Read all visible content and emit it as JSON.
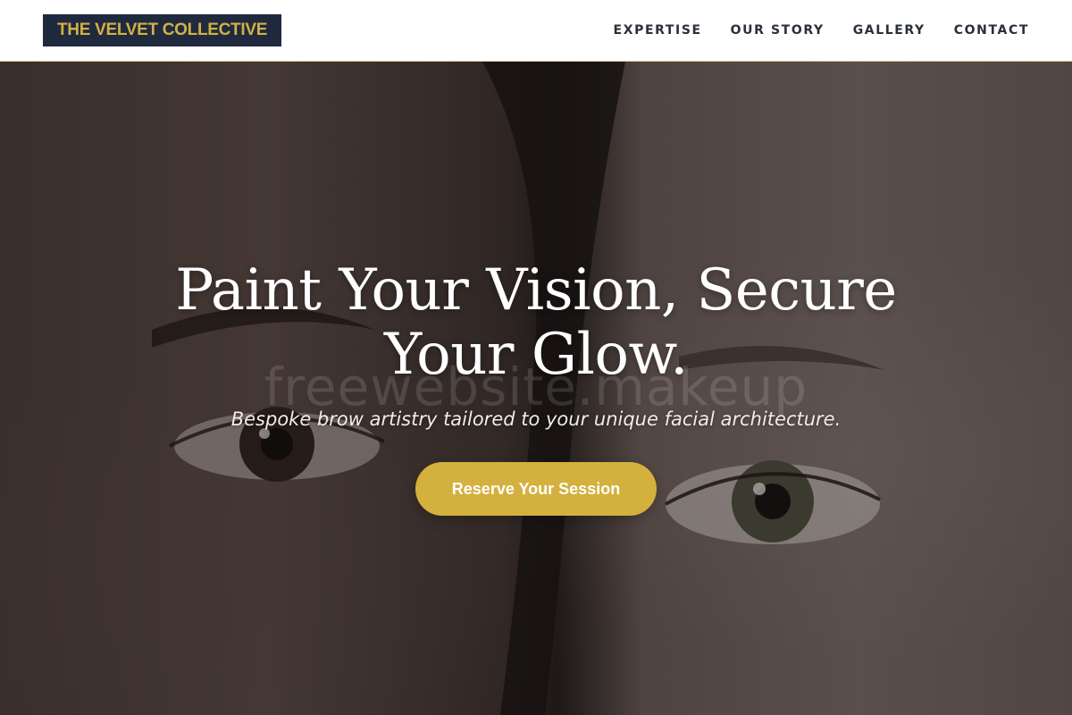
{
  "brand": {
    "name": "THE VELVET COLLECTIVE"
  },
  "nav": {
    "items": [
      {
        "label": "EXPERTISE"
      },
      {
        "label": "OUR STORY"
      },
      {
        "label": "GALLERY"
      },
      {
        "label": "CONTACT"
      }
    ]
  },
  "hero": {
    "title": "Paint Your Vision, Secure Your Glow.",
    "watermark": "freewebsite.makeup",
    "subtitle": "Bespoke brow artistry tailored to your unique facial architecture.",
    "cta_label": "Reserve Your Session",
    "image_alt": "close-up-two-faces-eyes-photo"
  },
  "colors": {
    "accent_gold": "#d4b03e",
    "logo_bg": "#1f2a3f",
    "nav_text": "#2a2f3a"
  }
}
